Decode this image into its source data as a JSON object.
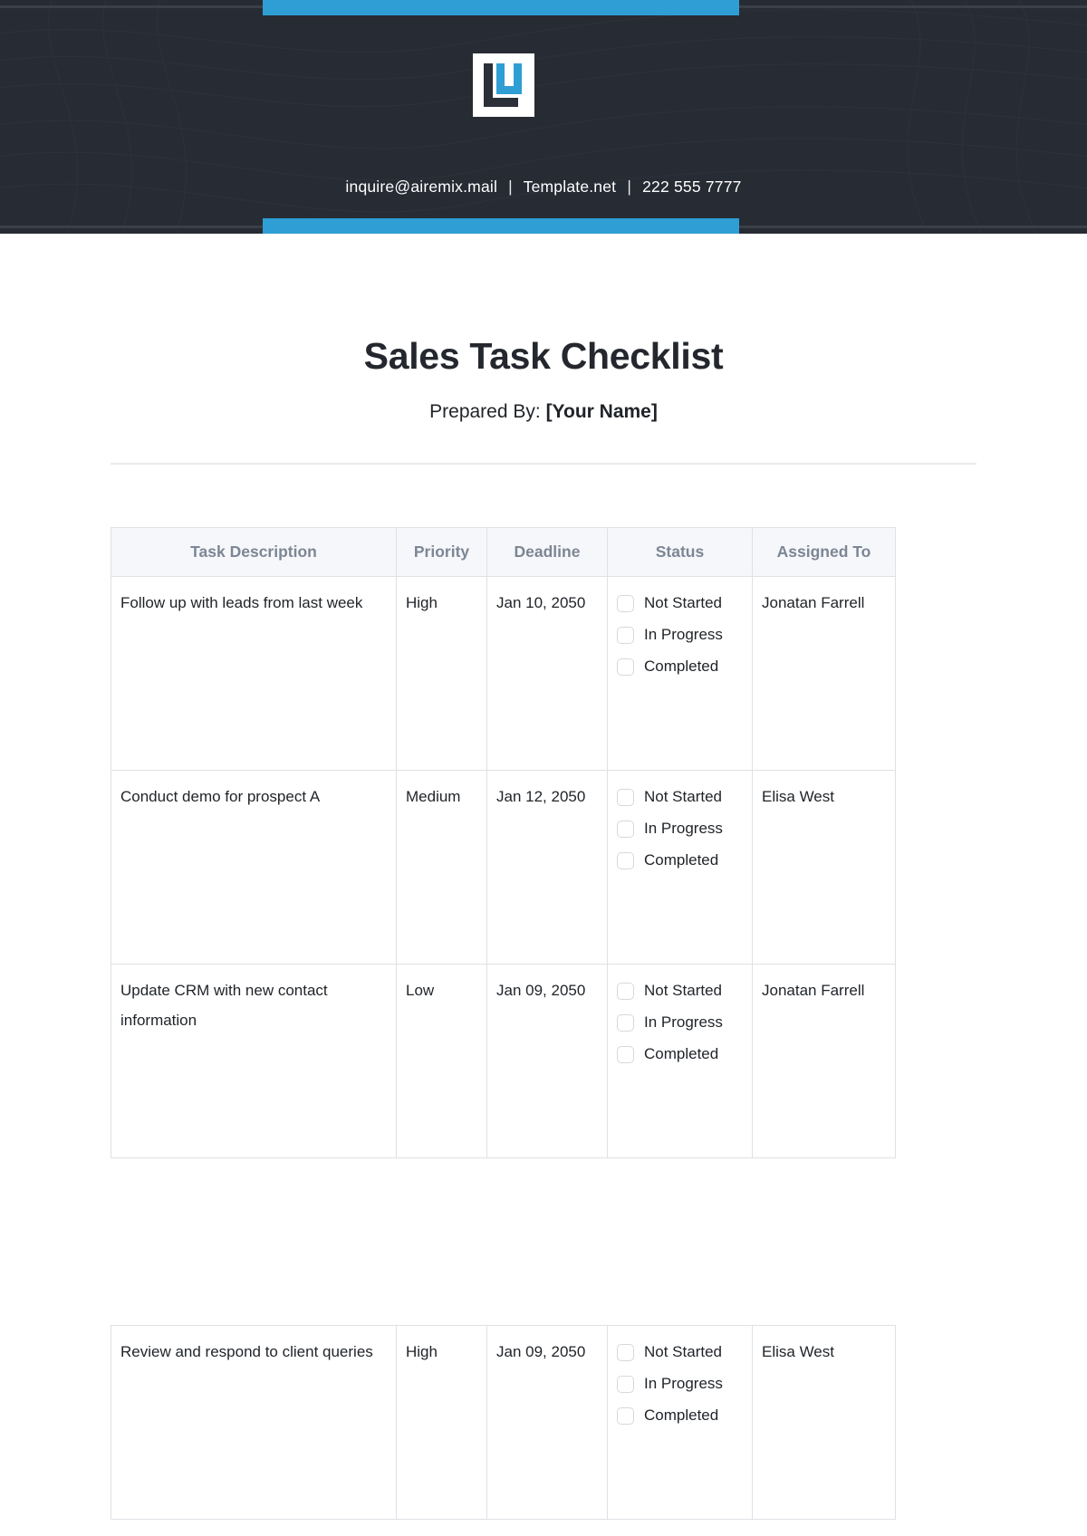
{
  "brand": {
    "logo_icon": "airemix-logo-icon",
    "accent_color": "#2f9ed4",
    "banner_color": "#272b33",
    "email": "inquire@airemix.mail",
    "website": "Template.net",
    "phone": "222 555 7777",
    "separator": "|"
  },
  "document": {
    "title": "Sales Task Checklist",
    "prepared_by_label": "Prepared By:",
    "prepared_by_value": "[Your Name]"
  },
  "table": {
    "columns": [
      "Task Description",
      "Priority",
      "Deadline",
      "Status",
      "Assigned To"
    ],
    "status_options": [
      "Not Started",
      "In Progress",
      "Completed"
    ],
    "rows": [
      {
        "task": "Follow up with leads from last week",
        "priority": "High",
        "deadline": "Jan 10, 2050",
        "status": [
          "Not Started",
          "In Progress",
          "Completed"
        ],
        "assigned_to": "Jonatan Farrell"
      },
      {
        "task": "Conduct demo for prospect A",
        "priority": "Medium",
        "deadline": "Jan 12, 2050",
        "status": [
          "Not Started",
          "In Progress",
          "Completed"
        ],
        "assigned_to": "Elisa West"
      },
      {
        "task": "Update CRM with new contact information",
        "priority": "Low",
        "deadline": "Jan 09, 2050",
        "status": [
          "Not Started",
          "In Progress",
          "Completed"
        ],
        "assigned_to": "Jonatan Farrell"
      },
      {
        "task": "Review and respond to client queries",
        "priority": "High",
        "deadline": "Jan 09, 2050",
        "status": [
          "Not Started",
          "In Progress",
          "Completed"
        ],
        "assigned_to": "Elisa West"
      }
    ]
  }
}
